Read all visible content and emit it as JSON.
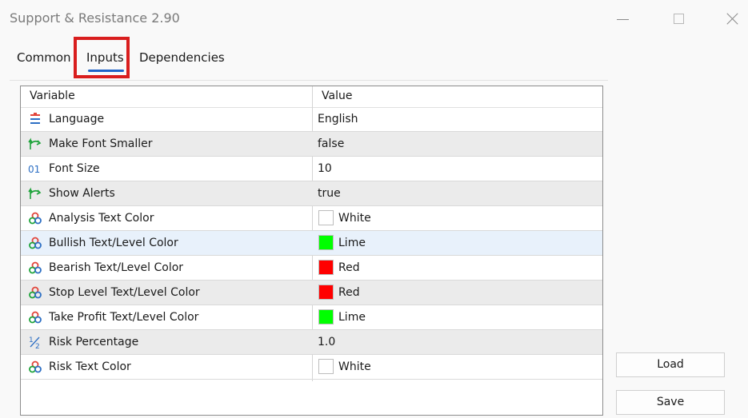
{
  "window": {
    "title": "Support & Resistance 2.90"
  },
  "tabs": [
    {
      "label": "Common"
    },
    {
      "label": "Inputs",
      "active": true
    },
    {
      "label": "Dependencies"
    }
  ],
  "grid": {
    "headers": {
      "variable": "Variable",
      "value": "Value"
    },
    "rows": [
      {
        "icon": "list-icon",
        "variable": "Language",
        "value": "English"
      },
      {
        "icon": "bool-arrow-icon",
        "variable": "Make Font Smaller",
        "value": "false"
      },
      {
        "icon": "integer-icon",
        "variable": "Font Size",
        "value": "10"
      },
      {
        "icon": "bool-arrow-icon",
        "variable": "Show Alerts",
        "value": "true"
      },
      {
        "icon": "color-icon",
        "variable": "Analysis Text Color",
        "value": "White",
        "swatch": "#ffffff"
      },
      {
        "icon": "color-icon",
        "variable": "Bullish Text/Level Color",
        "value": "Lime",
        "swatch": "#00ff00"
      },
      {
        "icon": "color-icon",
        "variable": "Bearish Text/Level Color",
        "value": "Red",
        "swatch": "#ff0000"
      },
      {
        "icon": "color-icon",
        "variable": "Stop Level Text/Level Color",
        "value": "Red",
        "swatch": "#ff0000"
      },
      {
        "icon": "color-icon",
        "variable": "Take Profit Text/Level Color",
        "value": "Lime",
        "swatch": "#00ff00"
      },
      {
        "icon": "fraction-icon",
        "variable": "Risk Percentage",
        "value": "1.0"
      },
      {
        "icon": "color-icon",
        "variable": "Risk Text Color",
        "value": "White",
        "swatch": "#ffffff"
      }
    ]
  },
  "buttons": {
    "load": "Load",
    "save": "Save"
  },
  "colors": {
    "accent": "#1e63c8",
    "highlight_box": "#d91e1e",
    "selected_row": "#e8f1fb"
  }
}
